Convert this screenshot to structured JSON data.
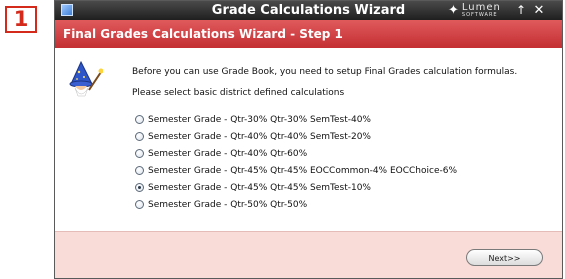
{
  "step_badge": "1",
  "window": {
    "title": "Grade Calculations Wizard",
    "brand_name": "Lumen",
    "brand_sub": "SOFTWARE",
    "pin_icon": "up-arrow-icon",
    "close_icon": "close-icon"
  },
  "header": {
    "title": "Final Grades Calculations Wizard - Step 1"
  },
  "content": {
    "intro": "Before you can use Grade Book, you need to setup Final Grades calculation formulas.",
    "prompt": "Please select basic district defined calculations",
    "options": [
      {
        "label": "Semester Grade - Qtr-30% Qtr-30% SemTest-40%",
        "selected": false
      },
      {
        "label": "Semester Grade - Qtr-40% Qtr-40% SemTest-20%",
        "selected": false
      },
      {
        "label": "Semester Grade - Qtr-40% Qtr-60%",
        "selected": false
      },
      {
        "label": "Semester Grade - Qtr-45% Qtr-45% EOCCommon-4% EOCChoice-6%",
        "selected": false
      },
      {
        "label": "Semester Grade - Qtr-45% Qtr-45% SemTest-10%",
        "selected": true
      },
      {
        "label": "Semester Grade - Qtr-50% Qtr-50%",
        "selected": false
      }
    ]
  },
  "footer": {
    "next_label": "Next>>"
  },
  "colors": {
    "badge_red": "#d42a1c",
    "header_red": "#d9434a",
    "footer_pink": "#f9dbd8",
    "titlebar_dark": "#2a2a2a"
  }
}
